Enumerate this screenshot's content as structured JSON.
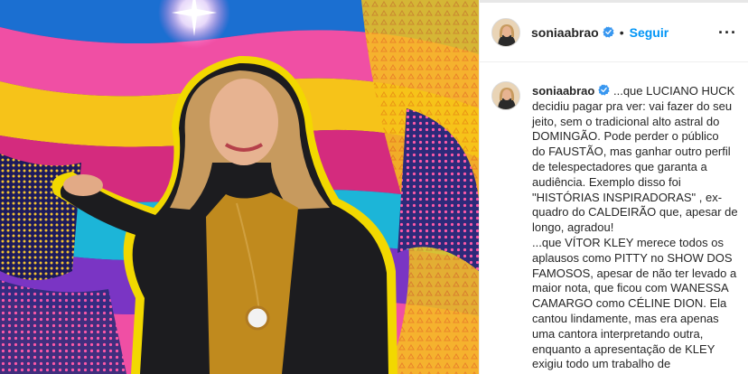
{
  "post": {
    "username": "soniaabrao",
    "separator": "•",
    "follow_label": "Seguir",
    "more_label": "···",
    "verified_icon": "verified-badge-icon",
    "accent_color": "#0095f6"
  },
  "caption": {
    "username": "soniaabrao",
    "text": "...que LUCIANO HUCK\ndecidiu pagar pra ver: vai fazer do seu\njeito, sem o tradicional alto astral do\nDOMINGÃO. Pode perder o público\ndo FAUSTÃO, mas ganhar outro perfil\nde telespectadores que garanta a\naudiência. Exemplo disso foi\n\"HISTÓRIAS INSPIRADORAS\" , ex-\nquadro do CALDEIRÃO que, apesar de\nlongo, agradou!\n...que VÍTOR KLEY merece todos os\naplausos como PITTY no SHOW DOS\nFAMOSOS, apesar de não ter levado a\nmaior nota, que ficou com WANESSA\nCAMARGO como CÉLINE DION. Ela\ncantou lindamente, mas era apenas\numa cantora interpretando outra,\nenquanto a apresentação de KLEY\nexigiu todo um trabalho de\ncomposição. Mereceu do júri!"
  }
}
